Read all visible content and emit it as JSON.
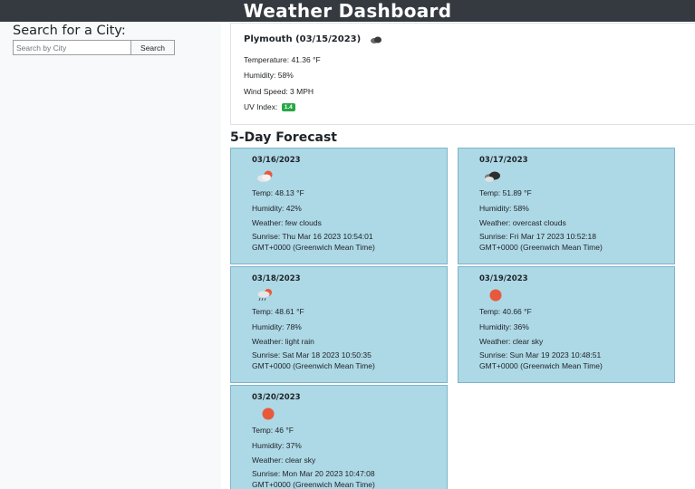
{
  "header": {
    "title": "Weather Dashboard"
  },
  "sidebar": {
    "heading": "Search for a City:",
    "search_placeholder": "Search by City",
    "search_button": "Search"
  },
  "current": {
    "title": "Plymouth (03/15/2023)",
    "icon": "overcast-clouds-icon",
    "temperature": "Temperature: 41.36 °F",
    "humidity": "Humidity: 58%",
    "wind": "Wind Speed: 3 MPH",
    "uv_label": "UV Index:",
    "uv_value": "1.4"
  },
  "forecast": {
    "heading": "5-Day Forecast",
    "days": [
      {
        "date": "03/16/2023",
        "icon": "few-clouds-icon",
        "temp": "Temp: 48.13 °F",
        "humidity": "Humidity: 42%",
        "weather": "Weather: few clouds",
        "sunrise1": "Sunrise: Thu Mar 16 2023 10:54:01",
        "sunrise2": "GMT+0000 (Greenwich Mean Time)"
      },
      {
        "date": "03/17/2023",
        "icon": "overcast-clouds-icon",
        "temp": "Temp: 51.89 °F",
        "humidity": "Humidity: 58%",
        "weather": "Weather: overcast clouds",
        "sunrise1": "Sunrise: Fri Mar 17 2023 10:52:18",
        "sunrise2": "GMT+0000 (Greenwich Mean Time)"
      },
      {
        "date": "03/18/2023",
        "icon": "light-rain-icon",
        "temp": "Temp: 48.61 °F",
        "humidity": "Humidity: 78%",
        "weather": "Weather: light rain",
        "sunrise1": "Sunrise: Sat Mar 18 2023 10:50:35",
        "sunrise2": "GMT+0000 (Greenwich Mean Time)"
      },
      {
        "date": "03/19/2023",
        "icon": "clear-sky-icon",
        "temp": "Temp: 40.66 °F",
        "humidity": "Humidity: 36%",
        "weather": "Weather: clear sky",
        "sunrise1": "Sunrise: Sun Mar 19 2023 10:48:51",
        "sunrise2": "GMT+0000 (Greenwich Mean Time)"
      },
      {
        "date": "03/20/2023",
        "icon": "clear-sky-icon",
        "temp": "Temp: 46 °F",
        "humidity": "Humidity: 37%",
        "weather": "Weather: clear sky",
        "sunrise1": "Sunrise: Mon Mar 20 2023 10:47:08",
        "sunrise2": "GMT+0000 (Greenwich Mean Time)"
      }
    ]
  },
  "colors": {
    "header_bg": "#343a40",
    "card_bg": "#add8e6",
    "uv_badge": "#28a745",
    "sun": "#e8593b"
  }
}
